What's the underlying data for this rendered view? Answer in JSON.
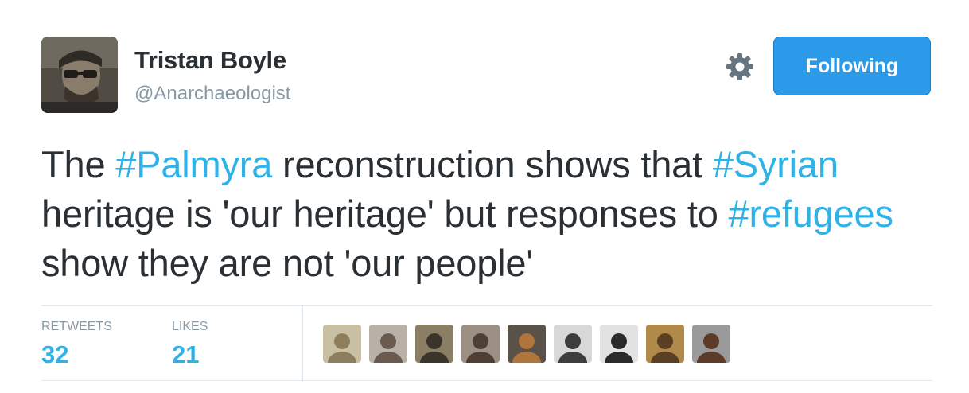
{
  "author": {
    "name": "Tristan Boyle",
    "handle": "@Anarchaeologist",
    "avatar_icon": "profile-photo-bearded-man-glasses"
  },
  "actions": {
    "settings_icon": "gear-icon",
    "follow_label": "Following",
    "follow_color": "#2b9ae9"
  },
  "tweet": {
    "parts": [
      {
        "text": "The ",
        "type": "text"
      },
      {
        "text": "#Palmyra",
        "type": "hashtag"
      },
      {
        "text": " reconstruction shows that ",
        "type": "text"
      },
      {
        "text": "#Syrian",
        "type": "hashtag"
      },
      {
        "text": " heritage is 'our heritage' but responses to ",
        "type": "text"
      },
      {
        "text": "#refugees",
        "type": "hashtag"
      },
      {
        "text": " show they are not 'our people'",
        "type": "text"
      }
    ],
    "hashtag_color": "#2fb2e8"
  },
  "stats": {
    "retweets_label": "RETWEETS",
    "retweets_count": "32",
    "likes_label": "LIKES",
    "likes_count": "21"
  },
  "likers": [
    {
      "icon": "manuscript-avatar",
      "colors": [
        "#c9bfa3",
        "#8c7d5c"
      ]
    },
    {
      "icon": "woman-outdoor-avatar",
      "colors": [
        "#b9b1a8",
        "#6b5a4e"
      ]
    },
    {
      "icon": "bearded-man-avatar",
      "colors": [
        "#8a7f64",
        "#3b342a"
      ]
    },
    {
      "icon": "curly-hair-man-avatar",
      "colors": [
        "#9c8f84",
        "#4e3e33"
      ]
    },
    {
      "icon": "greek-vase-avatar",
      "colors": [
        "#5a5149",
        "#b0753b"
      ]
    },
    {
      "icon": "bald-man-bw-avatar",
      "colors": [
        "#d8d8d8",
        "#3c3c3c"
      ]
    },
    {
      "icon": "man-with-hat-bw-avatar",
      "colors": [
        "#e2e2e2",
        "#2a2a2a"
      ]
    },
    {
      "icon": "bookshelf-man-avatar",
      "colors": [
        "#b08a4a",
        "#5a3f22"
      ]
    },
    {
      "icon": "long-hair-man-avatar",
      "colors": [
        "#9a9a9a",
        "#5e3a28"
      ]
    }
  ]
}
